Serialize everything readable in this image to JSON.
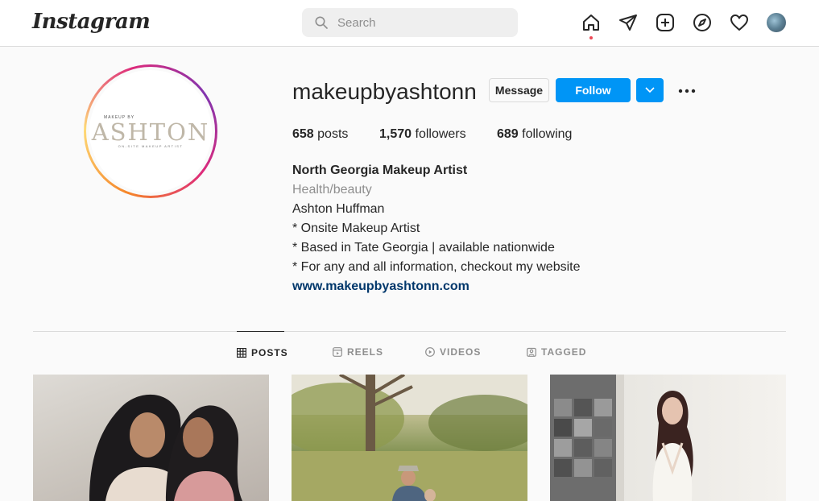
{
  "header": {
    "logo": "Instagram",
    "search_placeholder": "Search"
  },
  "nav_icons": [
    "home-icon",
    "direct-icon",
    "new-post-icon",
    "explore-icon",
    "activity-icon",
    "profile-avatar"
  ],
  "profile": {
    "username": "makeupbyashtonn",
    "pic_small": "MAKEUP BY",
    "pic_main": "ASHTON",
    "pic_tag": "ON-SITE MAKEUP ARTIST",
    "message_label": "Message",
    "follow_label": "Follow",
    "stats": {
      "posts_count": "658",
      "posts_label": "posts",
      "followers_count": "1,570",
      "followers_label": "followers",
      "following_count": "689",
      "following_label": "following"
    },
    "bio": {
      "name": "North Georgia Makeup Artist",
      "category": "Health/beauty",
      "lines": [
        "Ashton Huffman",
        "* Onsite Makeup Artist",
        "* Based in Tate Georgia | available nationwide",
        "* For any and all information, checkout my website"
      ],
      "link": "www.makeupbyashtonn.com"
    }
  },
  "tabs": [
    {
      "label": "POSTS",
      "icon": "grid-icon",
      "active": true
    },
    {
      "label": "REELS",
      "icon": "reels-icon",
      "active": false
    },
    {
      "label": "VIDEOS",
      "icon": "video-icon",
      "active": false
    },
    {
      "label": "TAGGED",
      "icon": "tagged-icon",
      "active": false
    }
  ],
  "colors": {
    "accent": "#0095f6",
    "link": "#00376b",
    "notification_dot": "#ed4956"
  }
}
